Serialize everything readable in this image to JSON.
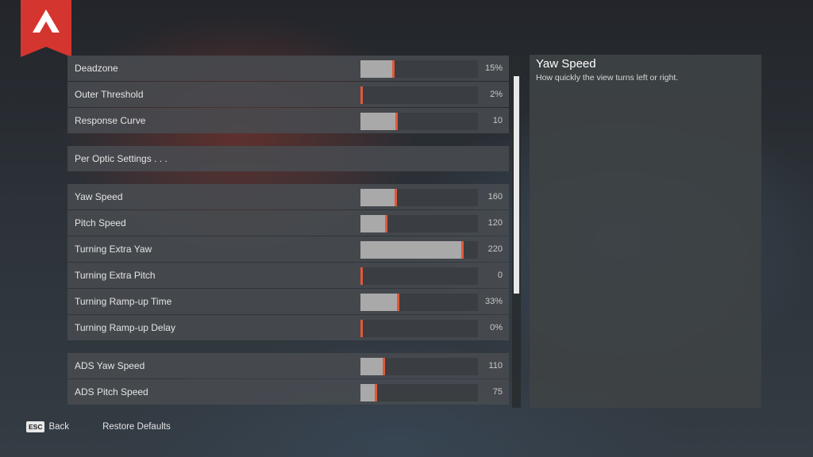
{
  "footer": {
    "back_key": "ESC",
    "back_label": "Back",
    "restore_label": "Restore Defaults"
  },
  "description": {
    "title": "Yaw Speed",
    "text": "How quickly the view turns left or right."
  },
  "groups": [
    [
      {
        "label": "Deadzone",
        "value": "15%",
        "level": 0.29
      },
      {
        "label": "Outer Threshold",
        "value": "2%",
        "level": 0.02
      },
      {
        "label": "Response Curve",
        "value": "10",
        "level": 0.32
      }
    ],
    [
      {
        "label": "Per Optic Settings . . ."
      }
    ],
    [
      {
        "label": "Yaw Speed",
        "value": "160",
        "level": 0.31
      },
      {
        "label": "Pitch Speed",
        "value": "120",
        "level": 0.23
      },
      {
        "label": "Turning Extra Yaw",
        "value": "220",
        "level": 0.88
      },
      {
        "label": "Turning Extra Pitch",
        "value": "0",
        "level": 0.0
      },
      {
        "label": "Turning Ramp-up Time",
        "value": "33%",
        "level": 0.33
      },
      {
        "label": "Turning Ramp-up Delay",
        "value": "0%",
        "level": 0.0
      }
    ],
    [
      {
        "label": "ADS Yaw Speed",
        "value": "110",
        "level": 0.21
      },
      {
        "label": "ADS Pitch Speed",
        "value": "75",
        "level": 0.14
      }
    ]
  ],
  "colors": {
    "accent": "#e2583a",
    "brand": "#d5352f",
    "slider_fill": "#a9a9a9"
  },
  "scrollbar": {
    "position": 0.06,
    "visible_fraction": 0.62
  }
}
